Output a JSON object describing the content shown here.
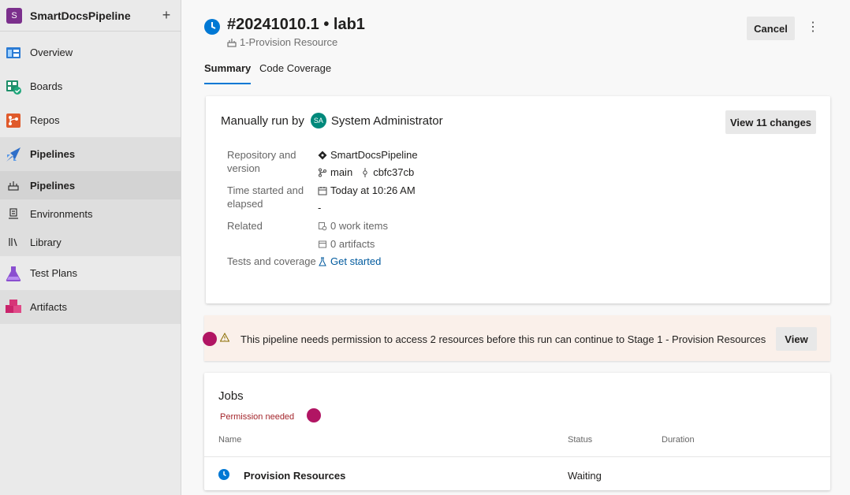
{
  "project": {
    "avatar_letter": "S",
    "name": "SmartDocsPipeline",
    "add_glyph": "+",
    "avatar_color": "#7b2f8c"
  },
  "nav": {
    "overview": "Overview",
    "boards": "Boards",
    "repos": "Repos",
    "pipelines": "Pipelines",
    "pipelines_sub": "Pipelines",
    "environments": "Environments",
    "library": "Library",
    "test_plans": "Test Plans",
    "artifacts": "Artifacts"
  },
  "header": {
    "title": "#20241010.1 • lab1",
    "stage": "1-Provision Resource",
    "cancel_label": "Cancel",
    "more_glyph": "⋮"
  },
  "tabs": {
    "summary": "Summary",
    "code_coverage": "Code Coverage"
  },
  "summary": {
    "run_by_label": "Manually run by",
    "user_initials": "SA",
    "user_name": "System Administrator",
    "view_changes_label": "View 11 changes",
    "repo_label": "Repository and version",
    "repo_name": "SmartDocsPipeline",
    "branch": "main",
    "commit": "cbfc37cb",
    "time_label": "Time started and elapsed",
    "time_started": "Today at 10:26 AM",
    "elapsed": "-",
    "related_label": "Related",
    "work_items": "0 work items",
    "artifacts": "0 artifacts",
    "tests_label": "Tests and coverage",
    "get_started": "Get started"
  },
  "banner": {
    "message": "This pipeline needs permission to access 2 resources before this run can continue to Stage 1 - Provision Resources",
    "view_label": "View"
  },
  "jobs": {
    "title": "Jobs",
    "permission_text": "Permission needed",
    "columns": [
      "Name",
      "Status",
      "Duration"
    ],
    "rows": [
      {
        "name": "Provision Resources",
        "status": "Waiting",
        "duration": ""
      }
    ]
  },
  "colors": {
    "accent": "#0078d4",
    "alert_dot": "#b11563",
    "permission_red": "#a4262c"
  }
}
